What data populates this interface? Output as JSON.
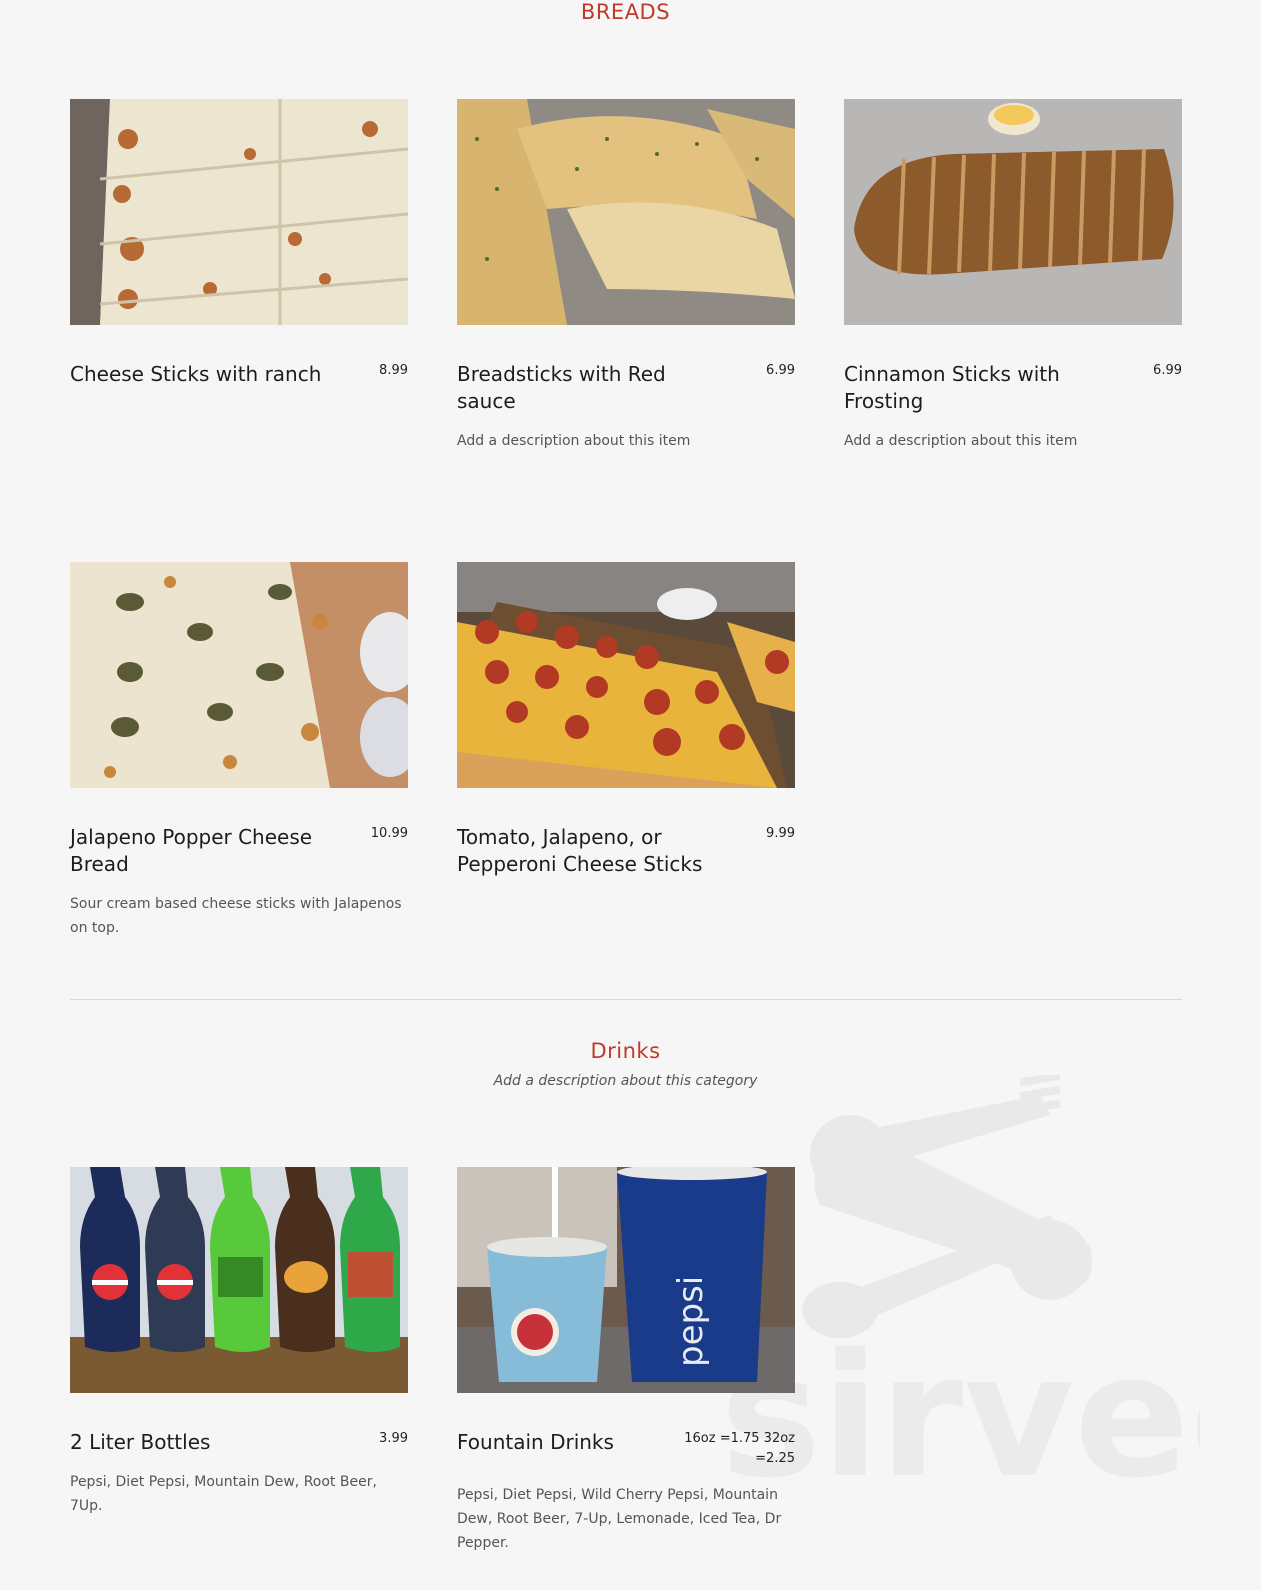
{
  "breads": {
    "title": "BREADS",
    "items": [
      {
        "name": "Cheese Sticks with ranch",
        "price": "8.99",
        "description": ""
      },
      {
        "name": "Breadsticks with Red sauce",
        "price": "6.99",
        "description": "Add a description about this item"
      },
      {
        "name": "Cinnamon Sticks with Frosting",
        "price": "6.99",
        "description": "Add a description about this item"
      },
      {
        "name": "Jalapeno Popper Cheese Bread",
        "price": "10.99",
        "description": "Sour cream based cheese sticks with Jalapenos on top."
      },
      {
        "name": "Tomato, Jalapeno, or Pepperoni Cheese Sticks",
        "price": "9.99",
        "description": ""
      }
    ]
  },
  "drinks": {
    "title": "Drinks",
    "description": "Add a description about this category",
    "items": [
      {
        "name": "2 Liter Bottles",
        "price": "3.99",
        "description": "Pepsi, Diet Pepsi, Mountain Dew, Root Beer, 7Up."
      },
      {
        "name": "Fountain Drinks",
        "price": "16oz =1.75 32oz =2.25",
        "description": "Pepsi, Diet Pepsi, Wild Cherry Pepsi, Mountain Dew, Root Beer, 7-Up, Lemonade, Iced Tea, Dr Pepper."
      }
    ]
  },
  "watermark": {
    "text": "sirved"
  },
  "colors": {
    "accent": "#c0392b",
    "background": "#f6f6f6"
  }
}
